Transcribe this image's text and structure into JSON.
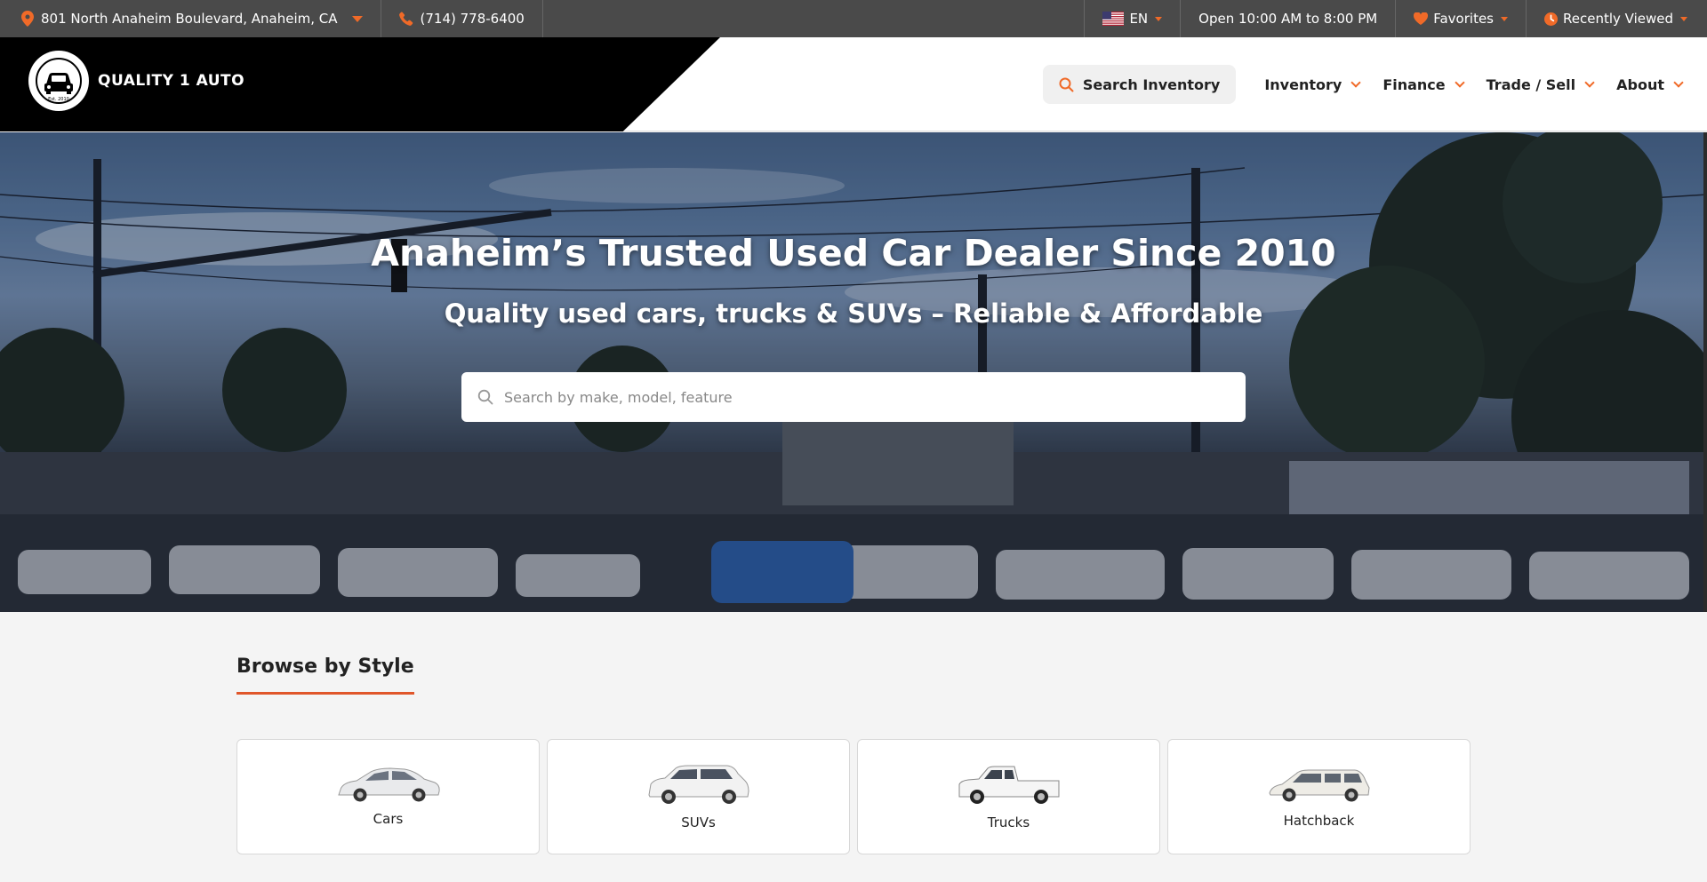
{
  "topbar": {
    "address": "801 North Anaheim Boulevard, Anaheim, CA",
    "phone": "(714) 778-6400",
    "language": "EN",
    "hours": "Open 10:00 AM to 8:00 PM",
    "favorites": "Favorites",
    "recently_viewed": "Recently Viewed"
  },
  "header": {
    "logo_text": "QUALITY 1 AUTO",
    "logo_est": "Est. 2010",
    "search_label": "Search Inventory",
    "nav": [
      "Inventory",
      "Finance",
      "Trade / Sell",
      "About"
    ]
  },
  "hero": {
    "title": "Anaheim’s Trusted Used Car Dealer Since 2010",
    "subtitle": "Quality used cars, trucks & SUVs – Reliable & Affordable",
    "search_placeholder": "Search by make, model, feature"
  },
  "browse": {
    "title": "Browse by Style",
    "styles": [
      {
        "label": "Cars",
        "icon": "sedan-icon"
      },
      {
        "label": "SUVs",
        "icon": "suv-icon"
      },
      {
        "label": "Trucks",
        "icon": "truck-icon"
      },
      {
        "label": "Hatchback",
        "icon": "wagon-icon"
      }
    ]
  },
  "colors": {
    "accent": "#f06a28",
    "topbar_bg": "#4a4a4a",
    "logo_band": "#000000"
  }
}
